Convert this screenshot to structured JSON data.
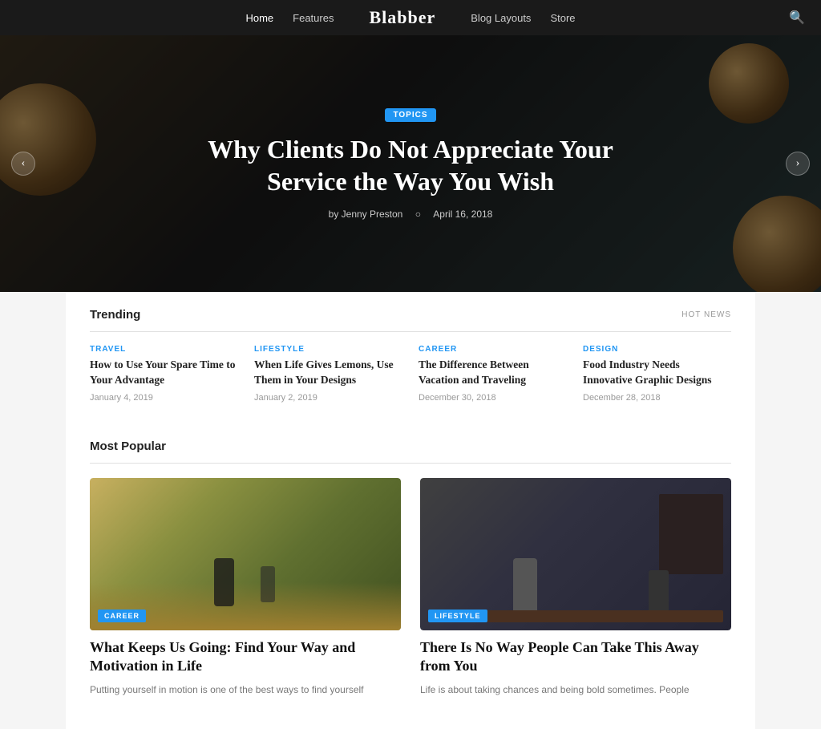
{
  "nav": {
    "links": [
      {
        "label": "Home",
        "active": true
      },
      {
        "label": "Features",
        "active": false
      },
      {
        "label": "Blog Layouts",
        "active": false
      },
      {
        "label": "Store",
        "active": false
      }
    ],
    "logo": "Blabber",
    "search_icon": "🔍"
  },
  "hero": {
    "tag": "TOPICS",
    "title": "Why Clients Do Not Appreciate Your Service the Way You Wish",
    "author": "by Jenny Preston",
    "date": "April 16, 2018",
    "prev_arrow": "‹",
    "next_arrow": "›"
  },
  "trending": {
    "section_title": "Trending",
    "hot_news_label": "HOT NEWS",
    "items": [
      {
        "category": "TRAVEL",
        "category_class": "cat-travel",
        "title": "How to Use Your Spare Time to Your Advantage",
        "date": "January 4, 2019"
      },
      {
        "category": "LIFESTYLE",
        "category_class": "cat-lifestyle",
        "title": "When Life Gives Lemons, Use Them in Your Designs",
        "date": "January 2, 2019"
      },
      {
        "category": "CAREER",
        "category_class": "cat-career",
        "title": "The Difference Between Vacation and Traveling",
        "date": "December 30, 2018"
      },
      {
        "category": "DESIGN",
        "category_class": "cat-design",
        "title": "Food Industry Needs Innovative Graphic Designs",
        "date": "December 28, 2018"
      }
    ]
  },
  "most_popular": {
    "section_title": "Most Popular",
    "cards": [
      {
        "category": "CAREER",
        "image_class": "img-running",
        "title": "What Keeps Us Going: Find Your Way and Motivation in Life",
        "excerpt": "Putting yourself in motion is one of the best ways to find yourself"
      },
      {
        "category": "LIFESTYLE",
        "image_class": "img-studio",
        "title": "There Is No Way People Can Take This Away from You",
        "excerpt": "Life is about taking chances and being bold sometimes. People"
      }
    ]
  }
}
